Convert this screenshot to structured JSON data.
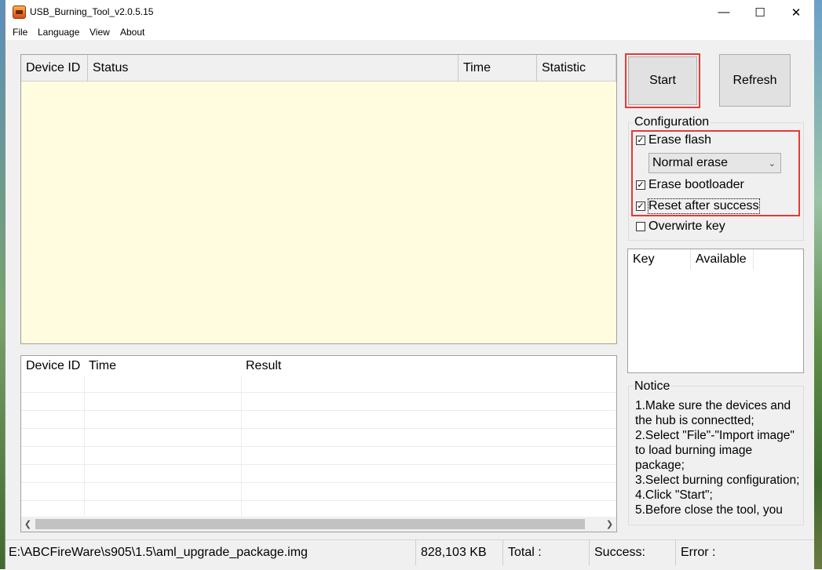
{
  "window": {
    "title": "USB_Burning_Tool_v2.0.5.15",
    "controls": {
      "minimize": "—",
      "maximize": "☐",
      "close": "✕"
    }
  },
  "menu": [
    "File",
    "Language",
    "View",
    "About"
  ],
  "device_table": {
    "columns": [
      "Device ID",
      "Status",
      "Time",
      "Statistic"
    ],
    "rows": []
  },
  "result_table": {
    "columns": [
      "Device ID",
      "Time",
      "Result"
    ],
    "rows": []
  },
  "buttons": {
    "start": "Start",
    "refresh": "Refresh"
  },
  "configuration": {
    "label": "Configuration",
    "erase_flash": {
      "label": "Erase flash",
      "checked": true
    },
    "erase_mode": {
      "selected": "Normal erase"
    },
    "erase_bootloader": {
      "label": "Erase bootloader",
      "checked": true
    },
    "reset_after_success": {
      "label": "Reset after success",
      "checked": true
    },
    "overwrite_key": {
      "label": "Overwirte key",
      "checked": false
    }
  },
  "key_table": {
    "columns": [
      "Key",
      "Available"
    ],
    "rows": []
  },
  "notice": {
    "label": "Notice",
    "text": "1.Make sure the devices and the hub is connectted;\n2.Select \"File\"-\"Import image\" to load burning image package;\n3.Select burning configuration;\n4.Click \"Start\";\n5.Before close the tool, you"
  },
  "status_bar": {
    "path": "E:\\ABCFireWare\\s905\\1.5\\aml_upgrade_package.img",
    "size": "828,103 KB",
    "total": "Total :",
    "success": "Success:",
    "error": "Error :"
  },
  "colors": {
    "highlight": "#e53935",
    "table_bg": "#fffce0"
  }
}
